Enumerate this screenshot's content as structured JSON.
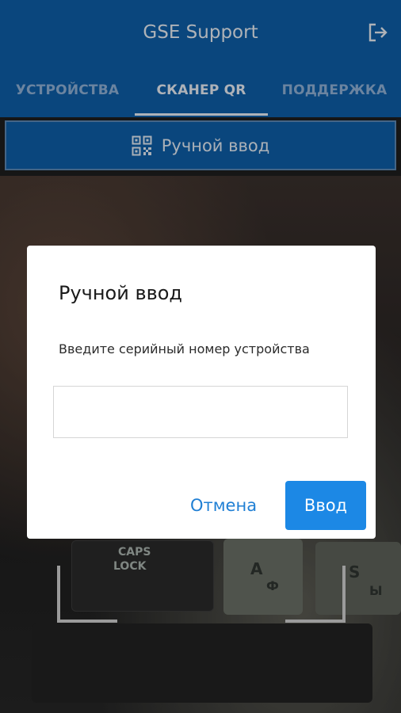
{
  "header": {
    "title": "GSE Support",
    "logout_icon": "logout-icon"
  },
  "tabs": [
    {
      "label": "УСТРОЙСТВА",
      "active": false
    },
    {
      "label": "СКАНЕР QR",
      "active": true
    },
    {
      "label": "ПОДДЕРЖКА",
      "active": false
    }
  ],
  "manual_entry": {
    "icon": "qr-code-icon",
    "label": "Ручной ввод"
  },
  "camera": {
    "keys": {
      "caps_line1": "CAPS",
      "caps_line2": "LOCK",
      "a_latin": "A",
      "a_cyrillic": "Ф",
      "s_latin": "S",
      "s_cyrillic": "Ы"
    }
  },
  "dialog": {
    "title": "Ручной ввод",
    "message": "Введите серийный номер устройства",
    "input_value": "",
    "cancel_label": "Отмена",
    "confirm_label": "Ввод"
  },
  "colors": {
    "appbar": "#0e5ea7",
    "accent": "#1c88e5",
    "tab_active": "#e8eef6",
    "tab_inactive": "#8fb1d6"
  }
}
